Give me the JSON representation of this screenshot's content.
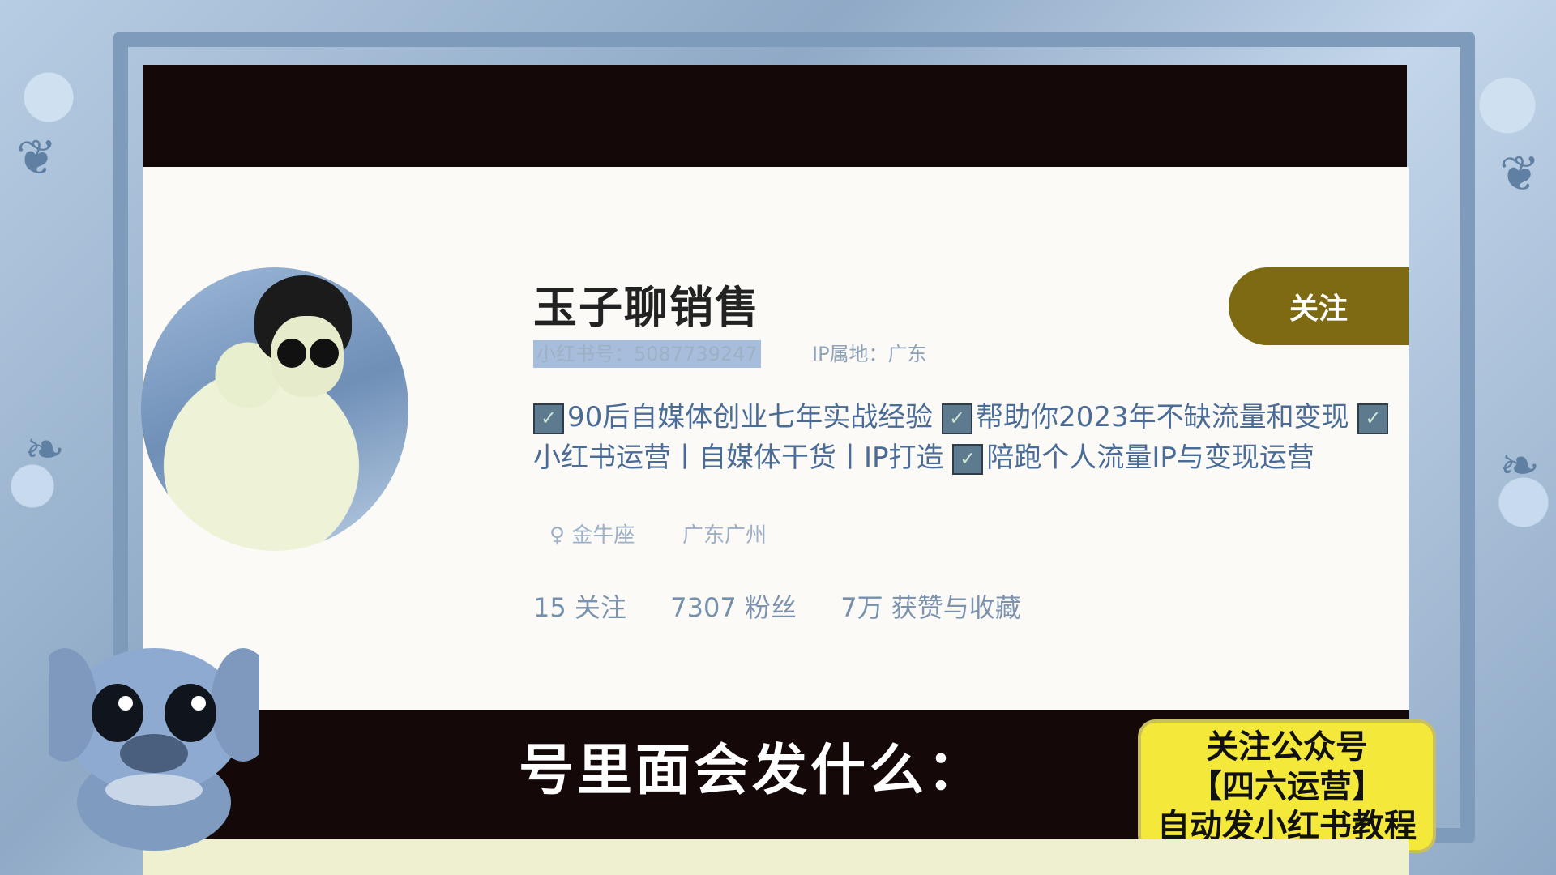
{
  "profile": {
    "username": "玉子聊销售",
    "rednote_id": "小红书号：5087739247",
    "ip_location": "IP属地：广东",
    "follow_label": "关注",
    "bio_line1": [
      "90后自媒体创业七年实战经验",
      "帮助你2023年不缺流量和变现"
    ],
    "bio_line2": [
      "小红书运营丨自媒体干货丨IP打造",
      "陪跑个人流量IP与变现运营"
    ],
    "zodiac": "金牛座",
    "city": "广东广州",
    "stats": {
      "following_count": "15",
      "following_label": "关注",
      "followers_count": "7307",
      "followers_label": "粉丝",
      "likes_count": "7万",
      "likes_label": "获赞与收藏"
    }
  },
  "subtitle": "号里面会发什么：",
  "promo": {
    "line1": "关注公众号",
    "line2": "【四六运营】",
    "line3": "自动发小红书教程"
  },
  "colors": {
    "follow_button": "#7d6a12",
    "promo_bg": "#f4e83a",
    "bar_bg": "#140808"
  }
}
